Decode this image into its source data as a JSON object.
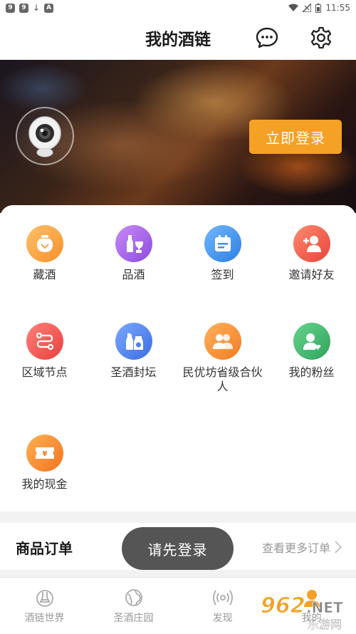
{
  "status_bar": {
    "time": "11:55",
    "left_icons": [
      "9",
      "9",
      "↓",
      "A"
    ]
  },
  "header": {
    "title": "我的酒链"
  },
  "banner": {
    "login_button": "立即登录"
  },
  "grid": {
    "items": [
      {
        "label": "藏酒",
        "icon": "jar-icon",
        "color": "#f7a33b"
      },
      {
        "label": "品酒",
        "icon": "bottle-glass-icon",
        "color": "#a35ee6"
      },
      {
        "label": "签到",
        "icon": "calendar-icon",
        "color": "#3d8fe8"
      },
      {
        "label": "邀请好友",
        "icon": "add-user-icon",
        "color": "#f2604e"
      },
      {
        "label": "区域节点",
        "icon": "route-icon",
        "color": "#f0544f"
      },
      {
        "label": "圣酒封坛",
        "icon": "sealed-jar-icon",
        "color": "#4d7fe6"
      },
      {
        "label": "民优坊省级合伙人",
        "icon": "partners-icon",
        "color": "#f79a3a"
      },
      {
        "label": "我的粉丝",
        "icon": "fan-user-icon",
        "color": "#3fb56b"
      },
      {
        "label": "我的现金",
        "icon": "cash-icon",
        "color": "#f58a2a"
      }
    ]
  },
  "orders": {
    "title": "商品订单",
    "more": "查看更多订单"
  },
  "toast": {
    "text": "请先登录"
  },
  "tabbar": {
    "tabs": [
      {
        "label": "酒链世界",
        "icon": "flask-icon"
      },
      {
        "label": "圣酒庄园",
        "icon": "globe-icon"
      },
      {
        "label": "发现",
        "icon": "signal-icon"
      },
      {
        "label": "我的",
        "icon": "user-icon"
      }
    ]
  },
  "watermark": {
    "text": "962.NET",
    "subtext": "乐游网"
  }
}
